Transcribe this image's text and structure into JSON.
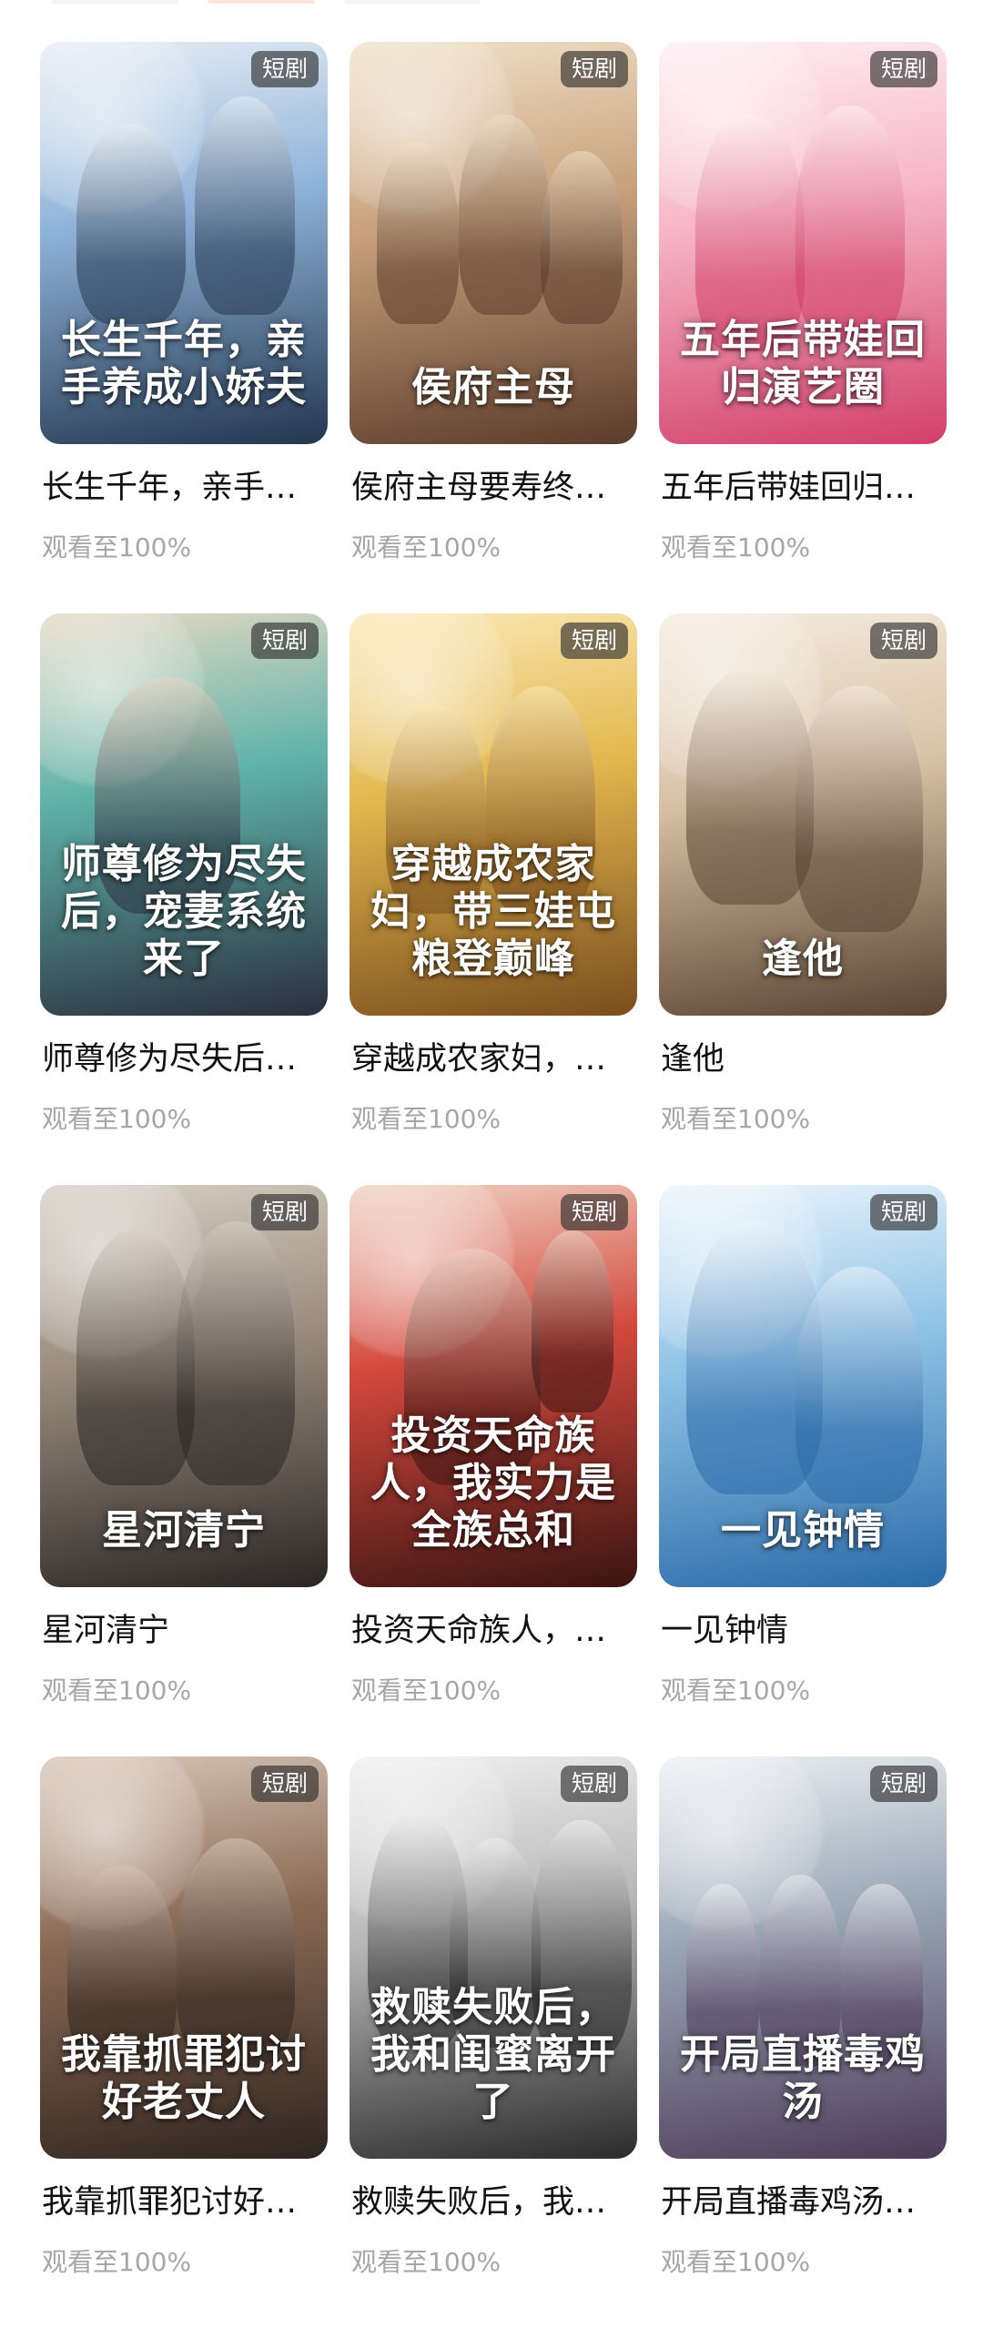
{
  "tag_label": "短剧",
  "progress_label": "观看至100%",
  "items": [
    {
      "title": "长生千年，亲手养成小娇夫",
      "display": "长生千年，亲手…",
      "poster_text": "长生千年，亲手养成小娇夫",
      "colors": [
        "#8fb4d9",
        "#23364f",
        "#e9eef5"
      ]
    },
    {
      "title": "侯府主母要寿终正寝",
      "display": "侯府主母要寿终…",
      "poster_text": "侯府主母",
      "colors": [
        "#c9a27e",
        "#5b3b2a",
        "#f1e3c9"
      ]
    },
    {
      "title": "五年后带娃回归演艺圈",
      "display": "五年后带娃回归…",
      "poster_text": "五年后带娃回归演艺圈",
      "colors": [
        "#f6b6c7",
        "#d23f6a",
        "#fff0f4"
      ]
    },
    {
      "title": "师尊修为尽失后，宠妻系统来了",
      "display": "师尊修为尽失后…",
      "poster_text": "师尊修为尽失后，宠妻系统来了",
      "colors": [
        "#5fb3a9",
        "#2b2f3d",
        "#e7d9c4"
      ]
    },
    {
      "title": "穿越成农家妇，带三娃屯粮登巅峰",
      "display": "穿越成农家妇，…",
      "poster_text": "穿越成农家妇，带三娃屯粮登巅峰",
      "colors": [
        "#e3b84e",
        "#7a4d1d",
        "#fbe9b7"
      ]
    },
    {
      "title": "逢他",
      "display": "逢他",
      "poster_text": "逢他",
      "colors": [
        "#d8c3a6",
        "#5a4332",
        "#f6ece0"
      ]
    },
    {
      "title": "星河清宁",
      "display": "星河清宁",
      "poster_text": "星河清宁",
      "colors": [
        "#9a8c7f",
        "#2b2624",
        "#d8cfc5"
      ]
    },
    {
      "title": "投资天命族人，我实力是全族总和",
      "display": "投资天命族人，…",
      "poster_text": "投资天命族人，我实力是全族总和",
      "colors": [
        "#d4483d",
        "#3a1512",
        "#f0d3c3"
      ]
    },
    {
      "title": "一见钟情",
      "display": "一见钟情",
      "poster_text": "一见钟情",
      "colors": [
        "#8fc3e6",
        "#2b6aa8",
        "#eef6fc"
      ]
    },
    {
      "title": "我靠抓罪犯讨好老丈人",
      "display": "我靠抓罪犯讨好…",
      "poster_text": "我靠抓罪犯讨好老丈人",
      "colors": [
        "#8a6a55",
        "#2f2520",
        "#d9c7b8"
      ]
    },
    {
      "title": "救赎失败后，我和闺蜜离开了",
      "display": "救赎失败后，我…",
      "poster_text": "救赎失败后，我和闺蜜离开了",
      "colors": [
        "#b7b7b7",
        "#2b2b2b",
        "#f1f1f1"
      ]
    },
    {
      "title": "开局直播毒鸡汤，着点笑死观众",
      "display": "开局直播毒鸡汤…",
      "poster_text": "开局直播毒鸡汤",
      "colors": [
        "#9aa7b5",
        "#4d3b58",
        "#eef1f5"
      ]
    }
  ]
}
